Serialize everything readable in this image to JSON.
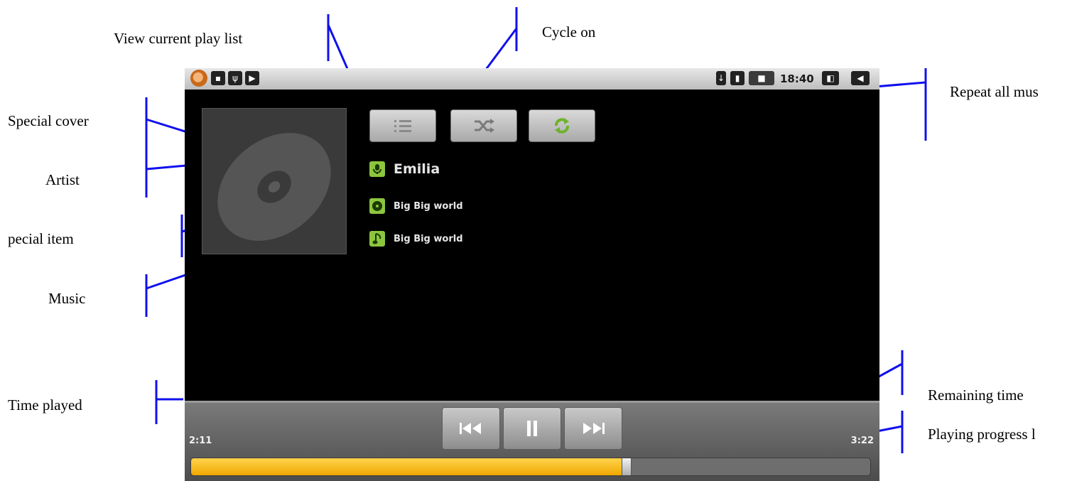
{
  "annotations": {
    "view_play_list": "View current play list",
    "cycle_on": "Cycle on",
    "repeat_all": "Repeat all mus",
    "special_cover": "Special cover",
    "artist": "Artist",
    "special_item": "pecial item",
    "music": "Music",
    "time_played": "Time played",
    "remaining_time": "Remaining time",
    "playing_progress": "Playing progress l"
  },
  "status_bar": {
    "time": "18:40",
    "left_icons": [
      "app-icon",
      "sd-card-icon",
      "usb-icon",
      "play-icon"
    ],
    "right_icons": [
      "download-icon",
      "signal-icon",
      "battery-icon",
      "network-icon",
      "volume-icon"
    ]
  },
  "player": {
    "artist": "Emilia",
    "album": "Big Big world",
    "track": "Big Big world",
    "time_played": "2:11",
    "time_remaining": "3:22",
    "progress": 0.64,
    "buttons": [
      "playlist-icon",
      "shuffle-icon",
      "repeat-icon",
      "previous-icon",
      "pause-icon",
      "next-icon"
    ],
    "accent_color": "#8cc63f",
    "progress_color": "#f5b400"
  }
}
